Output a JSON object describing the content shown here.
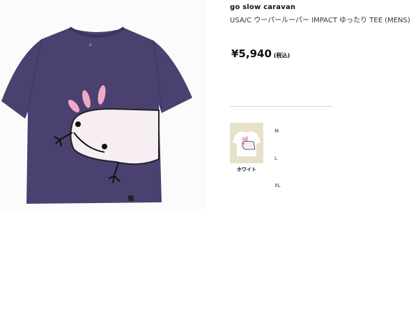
{
  "product": {
    "brand": "go slow caravan",
    "title": "USA/C ウーパールーパー IMPACT ゆったり TEE (MENS)",
    "price": "¥5,940",
    "tax_note": "(税込)",
    "image_icon": "purple-tshirt-axolotl-print",
    "colors": {
      "shirt": "#4a4170",
      "axolotl_body": "#f7eef3",
      "axolotl_gills": "#f2a9c6",
      "swatch_bg": "#e8e1c9"
    }
  },
  "variants": {
    "color_swatches": [
      {
        "label": "ホワイト",
        "icon": "white-tshirt-thumbnail"
      }
    ],
    "sizes": [
      "M",
      "L",
      "XL"
    ]
  }
}
